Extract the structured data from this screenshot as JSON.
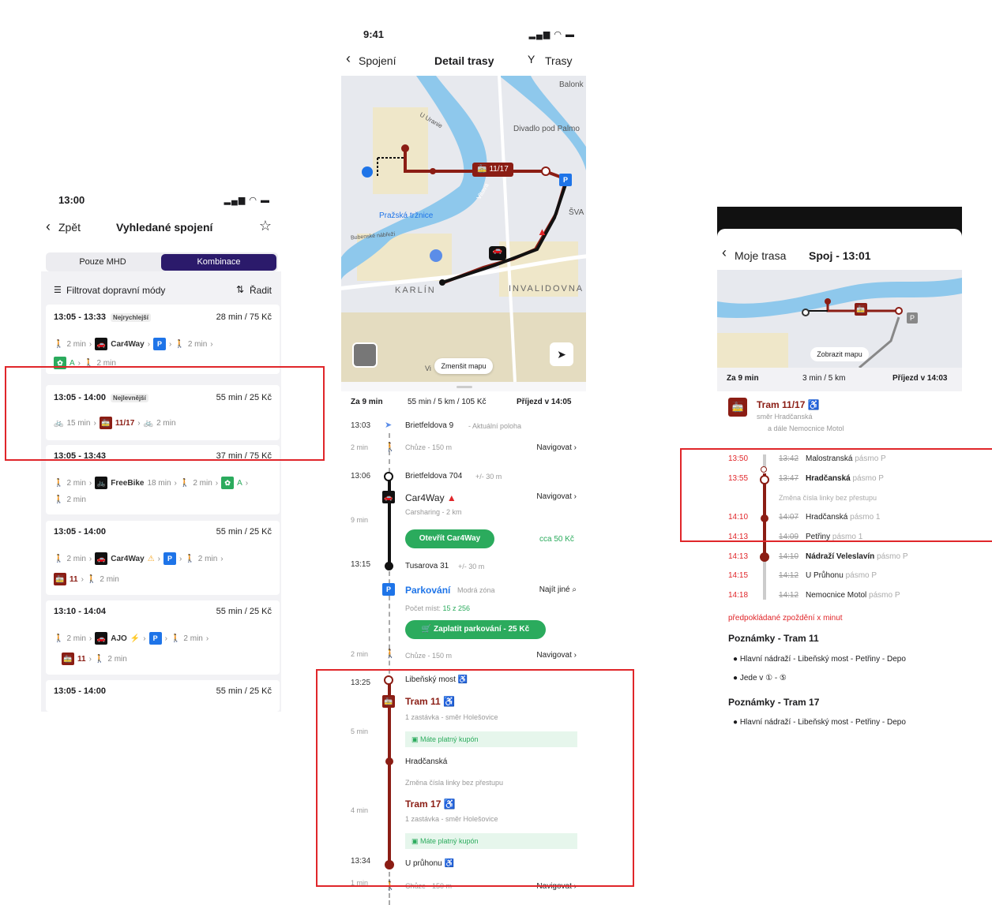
{
  "screen1": {
    "time": "13:00",
    "signal": "▂▄▆ ◠ ▬",
    "back": "Zpět",
    "title": "Vyhledané spojení",
    "star": "☆",
    "seg_left": "Pouze MHD",
    "seg_right": "Kombinace",
    "filter": "Filtrovat dopravní módy",
    "sort": "Řadit",
    "cards": [
      {
        "time": "13:05 - 13:33",
        "tag": "Nejrychlejší",
        "info": "28 min / 75 Kč",
        "walk1": "2 min",
        "car": "Car4Way",
        "walk2": "2 min",
        "walk3": "2 min",
        "zone": "A"
      },
      {
        "time": "13:05 - 14:00",
        "tag": "Nejlevnější",
        "info": "55 min / 25 Kč",
        "bike1": "15 min",
        "tram": "11/17",
        "bike2": "2 min"
      },
      {
        "time": "13:05 - 13:43",
        "info": "37 min / 75 Kč",
        "walk1": "2 min",
        "bike": "FreeBike",
        "bike_min": "18 min",
        "walk2": "2 min",
        "zone": "A",
        "walk3": "2 min"
      },
      {
        "time": "13:05 - 14:00",
        "info": "55 min / 25 Kč",
        "walk1": "2 min",
        "car": "Car4Way",
        "walk2": "2 min",
        "tram": "11",
        "walk3": "2 min"
      },
      {
        "time": "13:10 - 14:04",
        "info": "55 min / 25 Kč",
        "walk1": "2 min",
        "car": "AJO",
        "walk2": "2 min",
        "tram": "11",
        "walk3": "2 min"
      },
      {
        "time": "13:05 - 14:00",
        "info": "55 min / 25 Kč"
      }
    ]
  },
  "screen2": {
    "time": "9:41",
    "back": "Spojení",
    "title": "Detail trasy",
    "routes": "Trasy",
    "map_labels": {
      "balonk": "Balonk",
      "divadlo": "Divadlo pod Palmo",
      "trznice": "Pražská tržnice",
      "karlin": "KARLÍN",
      "invalidovna": "INVALIDOVNA",
      "vltava": "Vltava",
      "u_uranie": "U Uranie",
      "sva": "ŠVA",
      "bubenske": "Bubenské nábřeží",
      "tram_label": "11/17",
      "zmensit": "Zmenšit mapu",
      "vi": "Vi"
    },
    "summary": {
      "left": "Za 9 min",
      "mid": "55 min / 5 km / 105 Kč",
      "right": "Příjezd v 14:05"
    },
    "steps": {
      "t1303": "13:03",
      "brietfeldova9": "Brietfeldova 9",
      "aktualni": "- Aktuální poloha",
      "t2min_a": "2 min",
      "chuze_a": "Chůze - 150 m",
      "navigovat_a": "Navigovat",
      "t1306": "13:06",
      "brietfeldova704": "Brietfeldova 704",
      "plusminus_a": "+/- 30 m",
      "car4way": "Car4Way",
      "carsharing": "Carsharing - 2 km",
      "navigovat_b": "Navigovat",
      "t9min": "9 min",
      "otevrit": "Otevřít Car4Way",
      "cca": "cca 50 Kč",
      "t1315": "13:15",
      "tusarova": "Tusarova 31",
      "plusminus_b": "+/- 30 m",
      "parkovani": "Parkování",
      "modra": "Modrá zóna",
      "najit": "Najít jiné",
      "pocet": "Počet míst:",
      "pocet_val": "15 z 256",
      "zaplatit": "Zaplatit parkování - 25 Kč",
      "t2min_b": "2 min",
      "chuze_b": "Chůze - 150 m",
      "navigovat_c": "Navigovat",
      "t1325": "13:25",
      "libensky": "Libeňský most",
      "tram11": "Tram 11",
      "zast1": "1 zastávka - směr Holešovice",
      "t5min": "5 min",
      "kupon1": "Máte platný kupón",
      "hradcanska": "Hradčanská",
      "zmena": "Změna čísla linky bez přestupu",
      "t4min": "4 min",
      "tram17": "Tram 17",
      "zast2": "1 zastávka - směr Holešovice",
      "kupon2": "Máte platný kupón",
      "t1334": "13:34",
      "u_pruhonu": "U průhonu",
      "t1min": "1 min",
      "chuze_c": "Chůze - 150 m",
      "navigovat_d": "Navigovat"
    }
  },
  "screen3": {
    "back": "Moje trasa",
    "title": "Spoj - 13:01",
    "zobrazit": "Zobrazit mapu",
    "summary": {
      "left": "Za 9 min",
      "mid": "3 min / 5 km",
      "right": "Příjezd v 14:03"
    },
    "tram_title": "Tram 11/17",
    "smer": "směr Hradčanská",
    "dale": "a dále Nemocnice Motol",
    "stops": [
      {
        "new": "13:50",
        "old": "13:42",
        "name": "Malostranská",
        "zone": "pásmo P"
      },
      {
        "new": "13:55",
        "old": "13:47",
        "name": "Hradčanská",
        "zone": "pásmo P"
      },
      {
        "note": "Změna čísla linky bez přestupu"
      },
      {
        "new": "14:10",
        "old": "14:07",
        "name": "Hradčanská",
        "zone": "pásmo 1"
      },
      {
        "new": "14:13",
        "old": "14:09",
        "name": "Petřiny",
        "zone": "pásmo 1"
      },
      {
        "new": "14:13",
        "old": "14:10",
        "name": "Nádraží Veleslavín",
        "zone": "pásmo P"
      },
      {
        "new": "14:15",
        "old": "14:12",
        "name": "U Průhonu",
        "zone": "pásmo P"
      },
      {
        "new": "14:18",
        "old": "14:12",
        "name": "Nemocnice Motol",
        "zone": "pásmo P"
      }
    ],
    "delay": "předpokládané zpoždění x minut",
    "notes11_title": "Poznámky - Tram 11",
    "notes11_a": "Hlavní nádraží - Libeňský most - Petřiny - Depo",
    "notes11_b": "Jede v ① - ⑤",
    "notes17_title": "Poznámky - Tram 17",
    "notes17_a": "Hlavní nádraží - Libeňský most - Petřiny - Depo"
  }
}
